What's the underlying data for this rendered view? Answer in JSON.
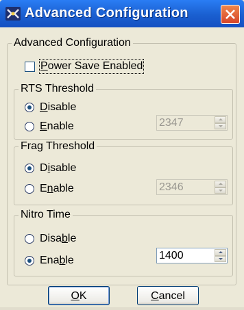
{
  "window": {
    "title": "Advanced Configuration",
    "close_label": "×"
  },
  "group_main": {
    "legend": "Advanced Configuration"
  },
  "power_save": {
    "label_pre": "",
    "label_mnemonic": "P",
    "label_post": "ower Save Enabled",
    "checked": false
  },
  "rts": {
    "legend": "RTS Threshold",
    "disable": {
      "pre": "",
      "mn": "D",
      "post": "isable",
      "selected": true
    },
    "enable": {
      "pre": "",
      "mn": "E",
      "post": "nable",
      "selected": false
    },
    "value": "2347",
    "spin_enabled": false
  },
  "frag": {
    "legend": "Frag Threshold",
    "disable": {
      "pre": "D",
      "mn": "i",
      "post": "sable",
      "selected": true
    },
    "enable": {
      "pre": "E",
      "mn": "n",
      "post": "able",
      "selected": false
    },
    "value": "2346",
    "spin_enabled": false
  },
  "nitro": {
    "legend": "Nitro Time",
    "disable": {
      "pre": "Disa",
      "mn": "b",
      "post": "le",
      "selected": false
    },
    "enable": {
      "pre": "Ena",
      "mn": "b",
      "post": "le",
      "selected": true
    },
    "value": "1400",
    "spin_enabled": true
  },
  "buttons": {
    "ok": {
      "mn": "O",
      "post": "K"
    },
    "cancel": {
      "mn": "C",
      "post": "ancel"
    }
  },
  "colors": {
    "title_bar": "#1a5fd0",
    "dialog_bg": "#ece9d8",
    "close_red": "#d6452a"
  }
}
